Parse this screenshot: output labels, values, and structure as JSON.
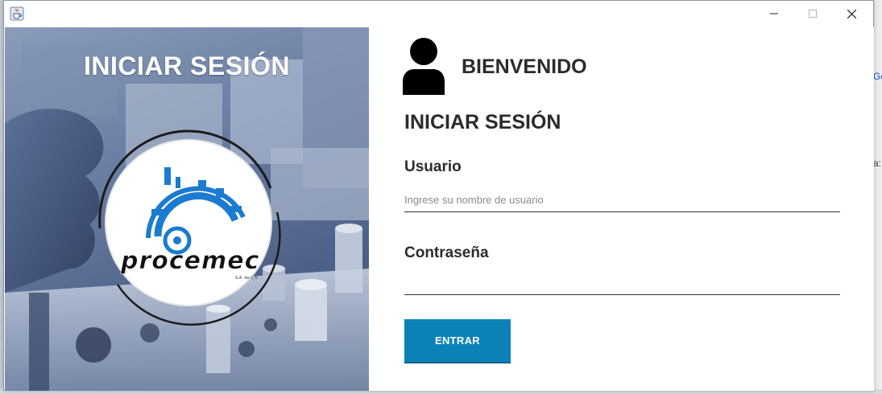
{
  "background": {
    "link_fragment": "Ge",
    "text_fragment": "a:"
  },
  "window": {
    "app_icon": "java-cup-icon",
    "controls": {
      "minimize": "minimize-icon",
      "maximize": "maximize-icon",
      "close": "close-icon"
    }
  },
  "left_panel": {
    "title": "INICIAR SESIÓN",
    "logo": {
      "brand": "procemec",
      "sub": "S.A. de C.V."
    }
  },
  "right_panel": {
    "avatar_icon": "user-icon",
    "welcome": "BIENVENIDO",
    "form_title": "INICIAR SESIÓN",
    "username": {
      "label": "Usuario",
      "placeholder": "Ingrese su nombre de usuario",
      "value": ""
    },
    "password": {
      "label": "Contraseña",
      "value": ""
    },
    "submit_label": "ENTRAR"
  },
  "colors": {
    "accent": "#0c83b8",
    "text": "#2b2b2b",
    "logo_blue": "#1b7bd0"
  }
}
